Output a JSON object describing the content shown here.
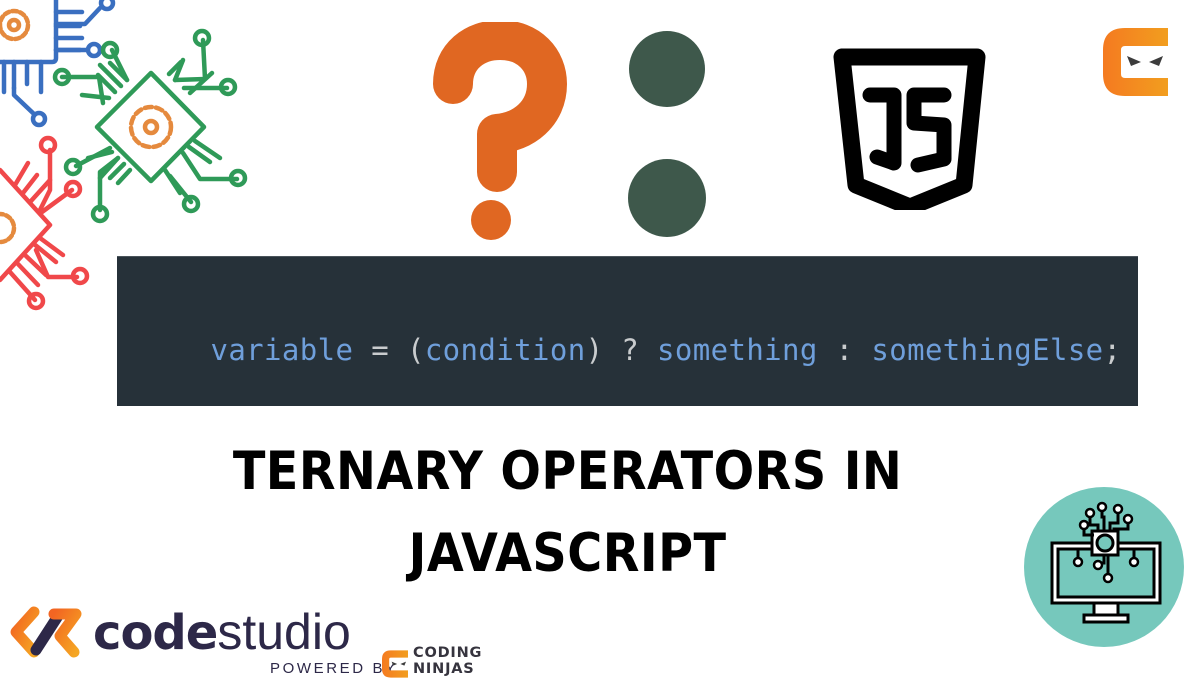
{
  "banner": {
    "code_snippet": {
      "tokens": [
        {
          "text": "variable",
          "kind": "identifier"
        },
        {
          "text": " = ",
          "kind": "operator"
        },
        {
          "text": "(",
          "kind": "operator"
        },
        {
          "text": "condition",
          "kind": "identifier"
        },
        {
          "text": ") ? ",
          "kind": "operator"
        },
        {
          "text": "something",
          "kind": "identifier"
        },
        {
          "text": " : ",
          "kind": "operator"
        },
        {
          "text": "somethingElse",
          "kind": "identifier"
        },
        {
          "text": ";",
          "kind": "operator"
        }
      ]
    },
    "title": {
      "line1": "TERNARY OPERATORS IN",
      "line2": "JAVASCRIPT"
    },
    "icons": {
      "question_mark": "question-mark-icon",
      "colon": "colon-icon",
      "js_shield": "javascript-shield-icon",
      "circuit_chips": "circuit-chip-icon",
      "monitor_badge": "monitor-circuit-icon",
      "brand_top": "coding-ninjas-logo"
    },
    "brand": {
      "product_bold": "code",
      "product_light": "studio",
      "powered_by": "POWERED BY",
      "company_line1": "CODING",
      "company_line2": "NINJAS"
    },
    "colors": {
      "question_orange": "#e06722",
      "colon_green": "#3e584b",
      "code_bg": "#263139",
      "code_identifier": "#6f9fdb",
      "code_operator": "#c9ccce",
      "badge_teal": "#76c8bc",
      "brand_navy": "#2d2848",
      "brand_orange_start": "#f47a20",
      "brand_orange_end": "#f29e1f",
      "chip_blue": "#3a6fc0",
      "chip_green": "#2f9a58",
      "chip_red": "#f0484a",
      "gear_orange": "#e58a3e"
    }
  }
}
